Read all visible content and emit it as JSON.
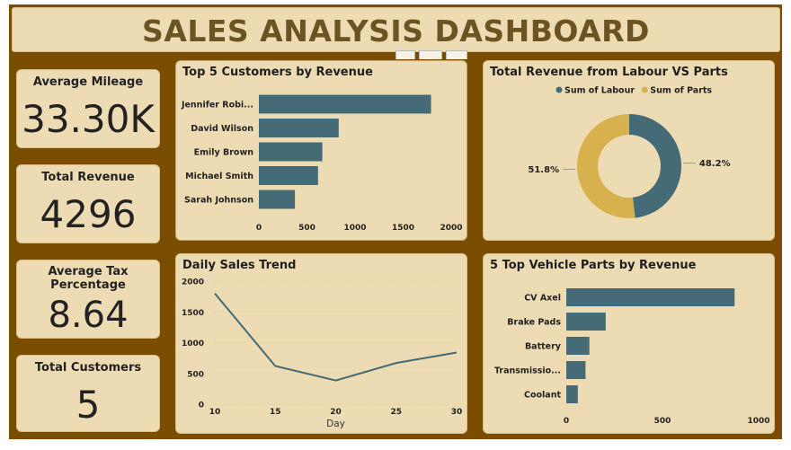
{
  "header": {
    "title": "SALES ANALYSIS DASHBOARD"
  },
  "kpis": [
    {
      "label": "Average Mileage",
      "value": "33.30K"
    },
    {
      "label": "Total Revenue",
      "value": "4296"
    },
    {
      "label": "Average Tax Percentage",
      "value": "8.64"
    },
    {
      "label": "Total Customers",
      "value": "5"
    }
  ],
  "colors": {
    "bar": "#446b76",
    "labour": "#446b76",
    "parts": "#d6b14d",
    "frame": "#7a4d00",
    "card": "#eddcb3"
  },
  "chart_data": [
    {
      "id": "top-customers",
      "type": "bar",
      "orientation": "horizontal",
      "title": "Top 5 Customers by Revenue",
      "categories": [
        "Jennifer Robi...",
        "David Wilson",
        "Emily Brown",
        "Michael Smith",
        "Sarah Johnson"
      ],
      "values": [
        1790,
        830,
        660,
        615,
        375
      ],
      "xlim": [
        0,
        2000
      ],
      "xticks": [
        "0",
        "500",
        "1000",
        "1500",
        "2000"
      ],
      "grid": false
    },
    {
      "id": "labour-vs-parts",
      "type": "pie",
      "donut": true,
      "title": "Total Revenue from Labour VS Parts",
      "legend": "top",
      "labels": [
        "Sum of Labour",
        "Sum of Parts"
      ],
      "values": [
        48.2,
        51.8
      ],
      "value_labels": [
        "48.2%",
        "51.8%"
      ]
    },
    {
      "id": "daily-sales",
      "type": "line",
      "title": "Daily Sales Trend",
      "xlabel": "Day",
      "x": [
        10,
        15,
        20,
        25,
        30
      ],
      "y": [
        1800,
        620,
        385,
        670,
        840
      ],
      "xlim": [
        10,
        30
      ],
      "ylim": [
        0,
        2000
      ],
      "xticks": [
        "10",
        "15",
        "20",
        "25",
        "30"
      ],
      "yticks": [
        "0",
        "500",
        "1000",
        "1500",
        "2000"
      ]
    },
    {
      "id": "top-parts",
      "type": "bar",
      "orientation": "horizontal",
      "title": "5 Top Vehicle Parts by Revenue",
      "categories": [
        "CV Axel",
        "Brake Pads",
        "Battery",
        "Transmissio...",
        "Coolant"
      ],
      "values": [
        875,
        205,
        120,
        100,
        60
      ],
      "xlim": [
        0,
        1000
      ],
      "xticks": [
        "0",
        "500",
        "1000"
      ],
      "grid": false
    }
  ]
}
